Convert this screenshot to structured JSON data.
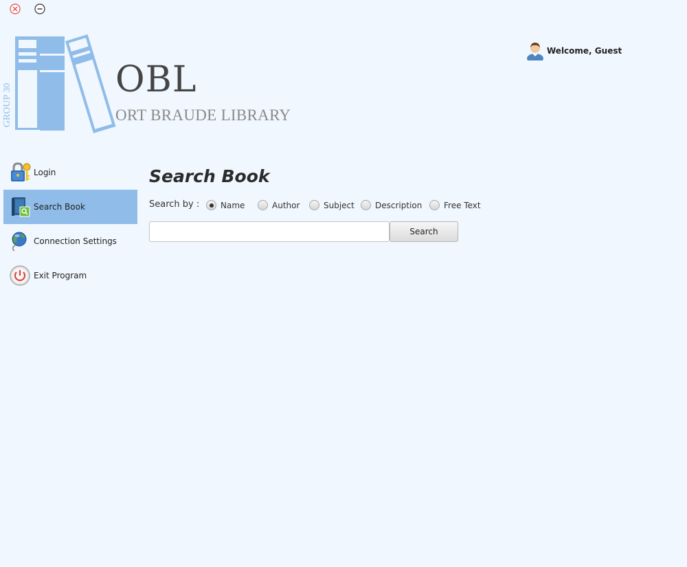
{
  "window": {
    "close_icon": "close-icon",
    "minimize_icon": "minimize-icon"
  },
  "logo": {
    "title": "OBL",
    "subtitle": "ORT BRAUDE LIBRARY",
    "group": "GROUP 30",
    "icon": "books-logo-icon"
  },
  "header": {
    "welcome_text": "Welcome, Guest",
    "avatar_icon": "user-avatar-icon"
  },
  "sidebar": {
    "items": [
      {
        "label": "Login",
        "icon": "lock-key-icon",
        "active": false
      },
      {
        "label": "Search Book",
        "icon": "book-search-icon",
        "active": true
      },
      {
        "label": "Connection Settings",
        "icon": "globe-connection-icon",
        "active": false
      },
      {
        "label": "Exit Program",
        "icon": "power-icon",
        "active": false
      }
    ]
  },
  "main": {
    "title": "Search Book",
    "search_by_label": "Search by :",
    "options": [
      {
        "label": "Name",
        "checked": true
      },
      {
        "label": "Author",
        "checked": false
      },
      {
        "label": "Subject",
        "checked": false
      },
      {
        "label": "Description",
        "checked": false
      },
      {
        "label": "Free Text",
        "checked": false
      }
    ],
    "search_value": "",
    "search_placeholder": "",
    "search_button_label": "Search"
  },
  "colors": {
    "background": "#f0f7fe",
    "accent": "#8fbce9",
    "close_red": "#e04a4a"
  }
}
